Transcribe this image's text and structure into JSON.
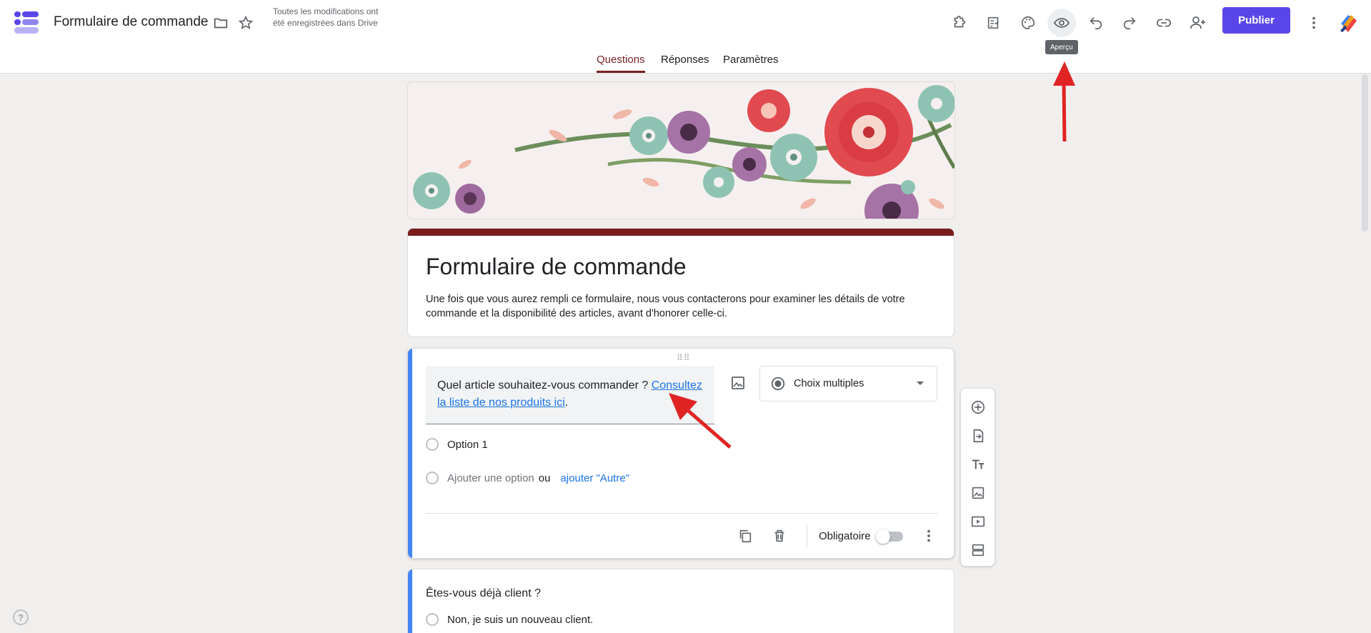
{
  "header": {
    "doc_title": "Formulaire de commande",
    "save_status": "Toutes les modifications ont été enregistrées dans Drive",
    "publish_label": "Publier",
    "tooltip": "Aperçu"
  },
  "tabs": [
    {
      "label": "Questions",
      "active": true
    },
    {
      "label": "Réponses",
      "active": false
    },
    {
      "label": "Paramètres",
      "active": false
    }
  ],
  "form": {
    "title": "Formulaire de commande",
    "description": "Une fois que vous aurez rempli ce formulaire, nous vous contacterons pour examiner les détails de votre commande et la disponibilité des articles, avant d'honorer celle-ci."
  },
  "question1": {
    "text_prefix": "Quel article souhaitez-vous commander ? ",
    "link_text": "Consultez la liste de nos produits ici",
    "text_suffix": ".",
    "type_label": "Choix multiples",
    "option1": "Option 1",
    "add_option": "Ajouter une option",
    "or_label": "ou",
    "add_other": "ajouter \"Autre\"",
    "required_label": "Obligatoire"
  },
  "question2": {
    "text": "Êtes-vous déjà client ?",
    "option1": "Non, je suis un nouveau client."
  },
  "help_label": "?",
  "colors": {
    "accent": "#5a46e8",
    "theme": "#7a1c1c",
    "question_bar": "#4285f4",
    "annotation": "#e02424"
  }
}
